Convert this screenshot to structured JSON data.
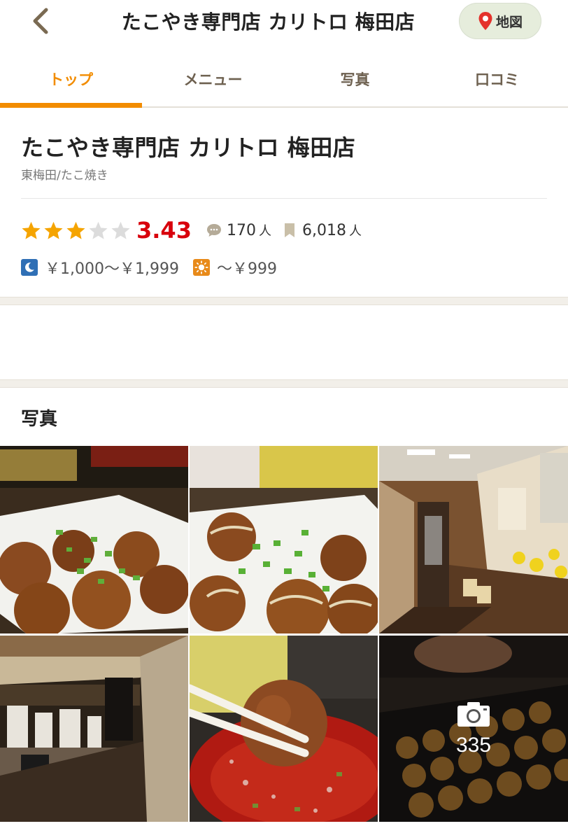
{
  "header": {
    "title": "たこやき専門店 カリトロ 梅田店",
    "map_label": "地図"
  },
  "tabs": [
    {
      "label": "トップ",
      "active": true
    },
    {
      "label": "メニュー",
      "active": false
    },
    {
      "label": "写真",
      "active": false
    },
    {
      "label": "口コミ",
      "active": false
    }
  ],
  "shop": {
    "name": "たこやき専門店 カリトロ 梅田店",
    "area_genre": "東梅田/たこ焼き",
    "rating": "3.43",
    "stars_filled": 3,
    "stars_total": 5,
    "review_count": "170",
    "review_unit": "人",
    "bookmark_count": "6,018",
    "bookmark_unit": "人",
    "dinner_price": "￥1,000～￥1,999",
    "lunch_price": "～￥999"
  },
  "photos": {
    "section_title": "写真",
    "more_count": "335",
    "items": [
      "takoyaki-plate-photo",
      "takoyaki-mayo-photo",
      "shop-interior-photo",
      "counter-interior-photo",
      "takoyaki-chopsticks-photo",
      "takoyaki-grill-photo"
    ]
  },
  "colors": {
    "accent": "#f28c00",
    "rating": "#d8000c",
    "star_on": "#f5a400",
    "star_off": "#dcdcdc",
    "moon_icon_bg": "#2f6fb5",
    "sun_icon_bg": "#e88a1a"
  },
  "icons": {
    "back": "chevron-left-icon",
    "map": "map-pin-icon",
    "review": "speech-bubble-icon",
    "bookmark": "bookmark-icon",
    "dinner": "moon-icon",
    "lunch": "sun-icon",
    "camera": "camera-icon"
  }
}
